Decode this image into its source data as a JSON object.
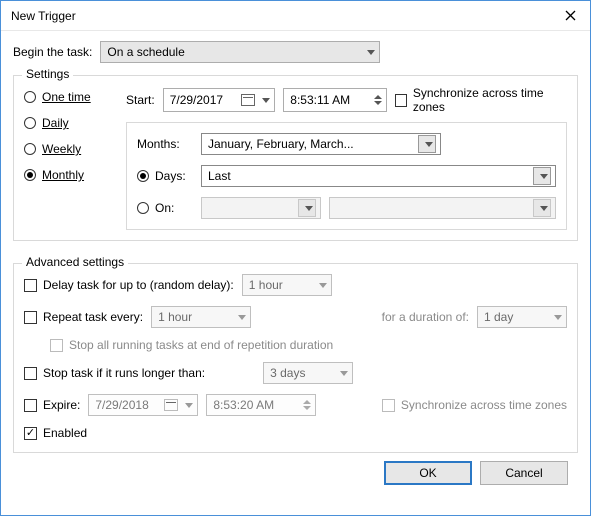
{
  "window": {
    "title": "New Trigger"
  },
  "begin": {
    "label": "Begin the task:",
    "value": "On a schedule"
  },
  "settings": {
    "label": "Settings",
    "schedule": {
      "one_time": "One time",
      "daily": "Daily",
      "weekly": "Weekly",
      "monthly": "Monthly"
    },
    "start_label": "Start:",
    "start_date": "7/29/2017",
    "start_time": "8:53:11 AM",
    "sync_tz": "Synchronize across time zones",
    "months_label": "Months:",
    "months_value": "January, February, March...",
    "days_label": "Days:",
    "days_value": "Last",
    "on_label": "On:",
    "on_value1": "",
    "on_value2": ""
  },
  "advanced": {
    "label": "Advanced settings",
    "delay_label": "Delay task for up to (random delay):",
    "delay_value": "1 hour",
    "repeat_label": "Repeat task every:",
    "repeat_value": "1 hour",
    "duration_label": "for a duration of:",
    "duration_value": "1 day",
    "stop_rep_label": "Stop all running tasks at end of repetition duration",
    "stop_long_label": "Stop task if it runs longer than:",
    "stop_long_value": "3 days",
    "expire_label": "Expire:",
    "expire_date": "7/29/2018",
    "expire_time": "8:53:20 AM",
    "sync_tz": "Synchronize across time zones",
    "enabled_label": "Enabled"
  },
  "buttons": {
    "ok": "OK",
    "cancel": "Cancel"
  }
}
